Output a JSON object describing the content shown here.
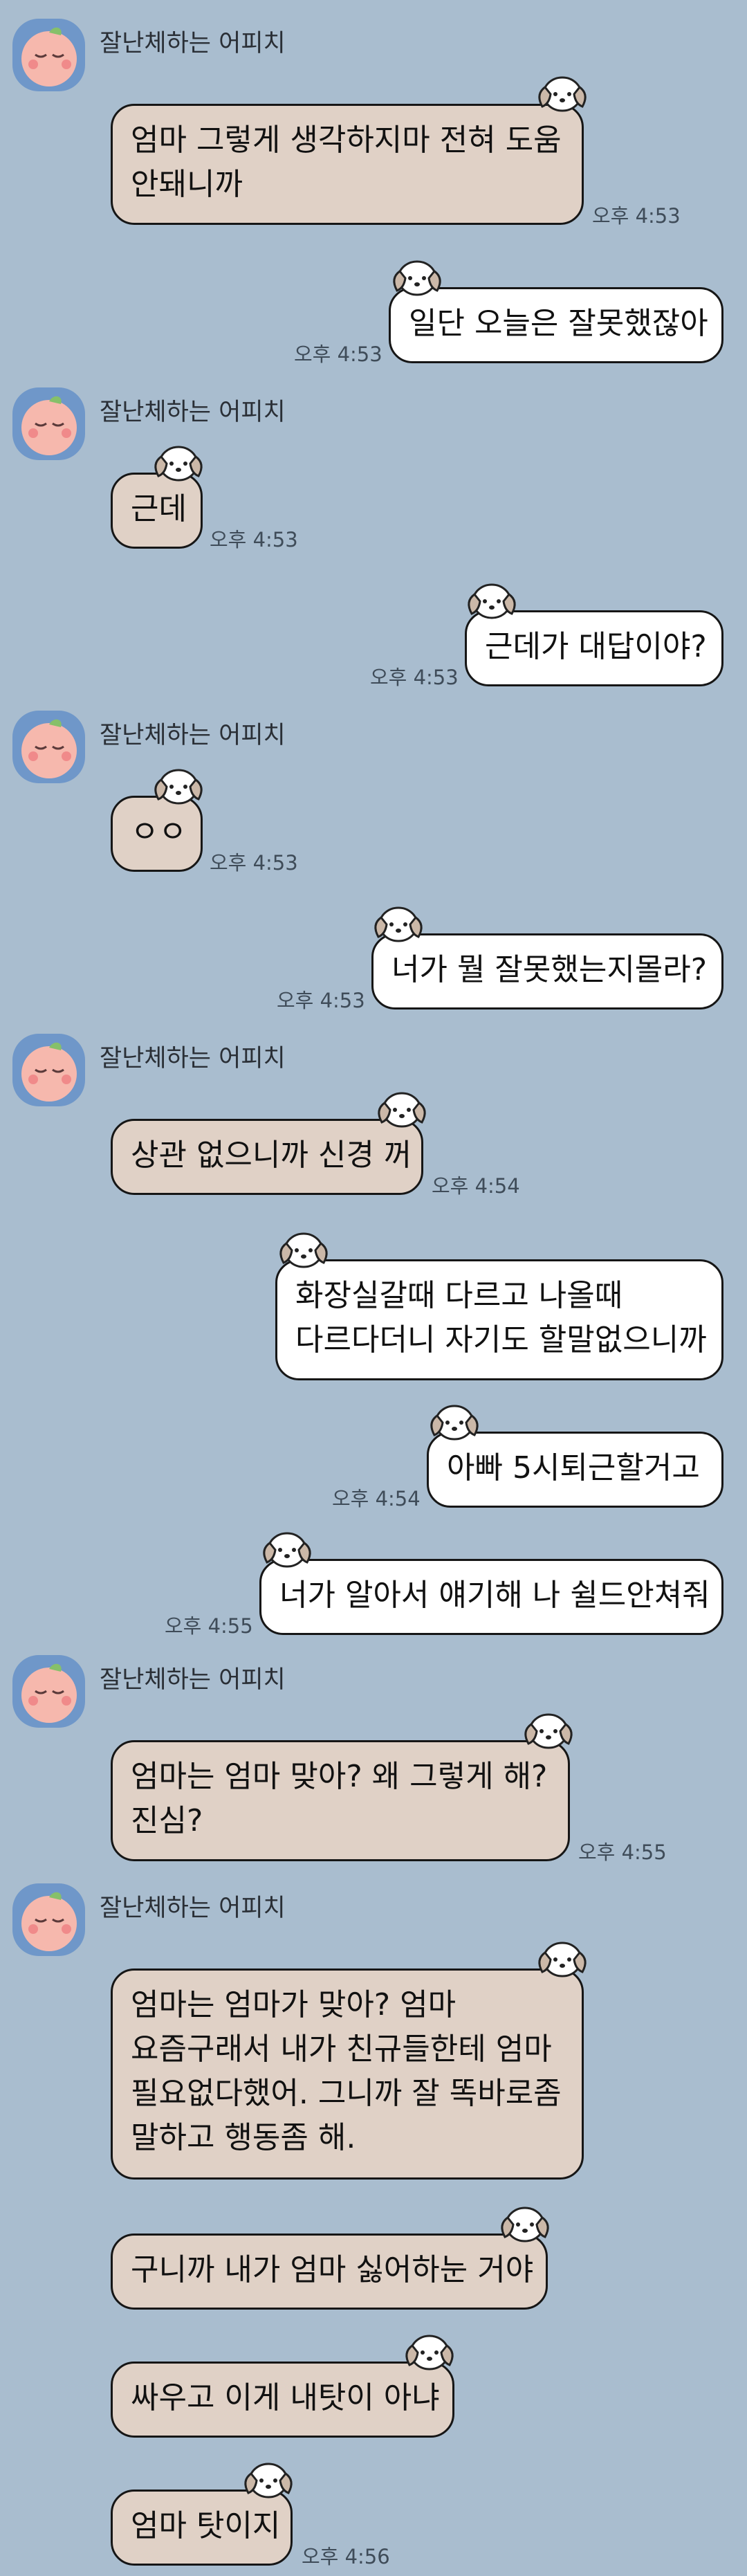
{
  "sender_name": "잘난체하는 어피치",
  "messages": [
    {
      "side": "in",
      "lines": [
        "엄마 그렇게 생각하지마 전혀 도움",
        "안돼니까"
      ],
      "time": "오후 4:53"
    },
    {
      "side": "out",
      "lines": [
        "일단 오늘은 잘못했잖아"
      ],
      "time": "오후 4:53"
    },
    {
      "side": "in",
      "lines": [
        "근데"
      ],
      "time": "오후 4:53"
    },
    {
      "side": "out",
      "lines": [
        "근데가 대답이야?"
      ],
      "time": "오후 4:53"
    },
    {
      "side": "in",
      "lines": [
        "ㅇㅇ"
      ],
      "time": "오후 4:53"
    },
    {
      "side": "out",
      "lines": [
        "너가 뭘 잘못했는지몰라?"
      ],
      "time": "오후 4:53"
    },
    {
      "side": "in",
      "lines": [
        "상관 없으니까 신경 꺼"
      ],
      "time": "오후 4:54"
    },
    {
      "side": "out",
      "lines": [
        "화장실갈때 다르고 나올때",
        "다르다더니 자기도 할말없으니까"
      ],
      "time": ""
    },
    {
      "side": "out",
      "lines": [
        "아빠 5시퇴근할거고"
      ],
      "time": "오후 4:54"
    },
    {
      "side": "out",
      "lines": [
        "너가 알아서 얘기해 나 쉴드안쳐줘"
      ],
      "time": "오후 4:55"
    },
    {
      "side": "in",
      "lines": [
        "엄마는 엄마 맞아? 왜 그렇게 해?",
        "진심?"
      ],
      "time": "오후 4:55"
    },
    {
      "side": "in",
      "lines": [
        "엄마는 엄마가 맞아? 엄마",
        "요즘구래서 내가 친규들한테 엄마",
        "필요없다했어. 그니까 잘 똑바로좀",
        "말하고 행동좀 해."
      ],
      "time": ""
    },
    {
      "side": "in",
      "lines": [
        "구니까 내가 엄마 싫어하눈 거야"
      ],
      "time": ""
    },
    {
      "side": "in",
      "lines": [
        "싸우고 이게 내탓이 아냐"
      ],
      "time": ""
    },
    {
      "side": "in",
      "lines": [
        "엄마 탓이지"
      ],
      "time": "오후 4:56"
    }
  ]
}
